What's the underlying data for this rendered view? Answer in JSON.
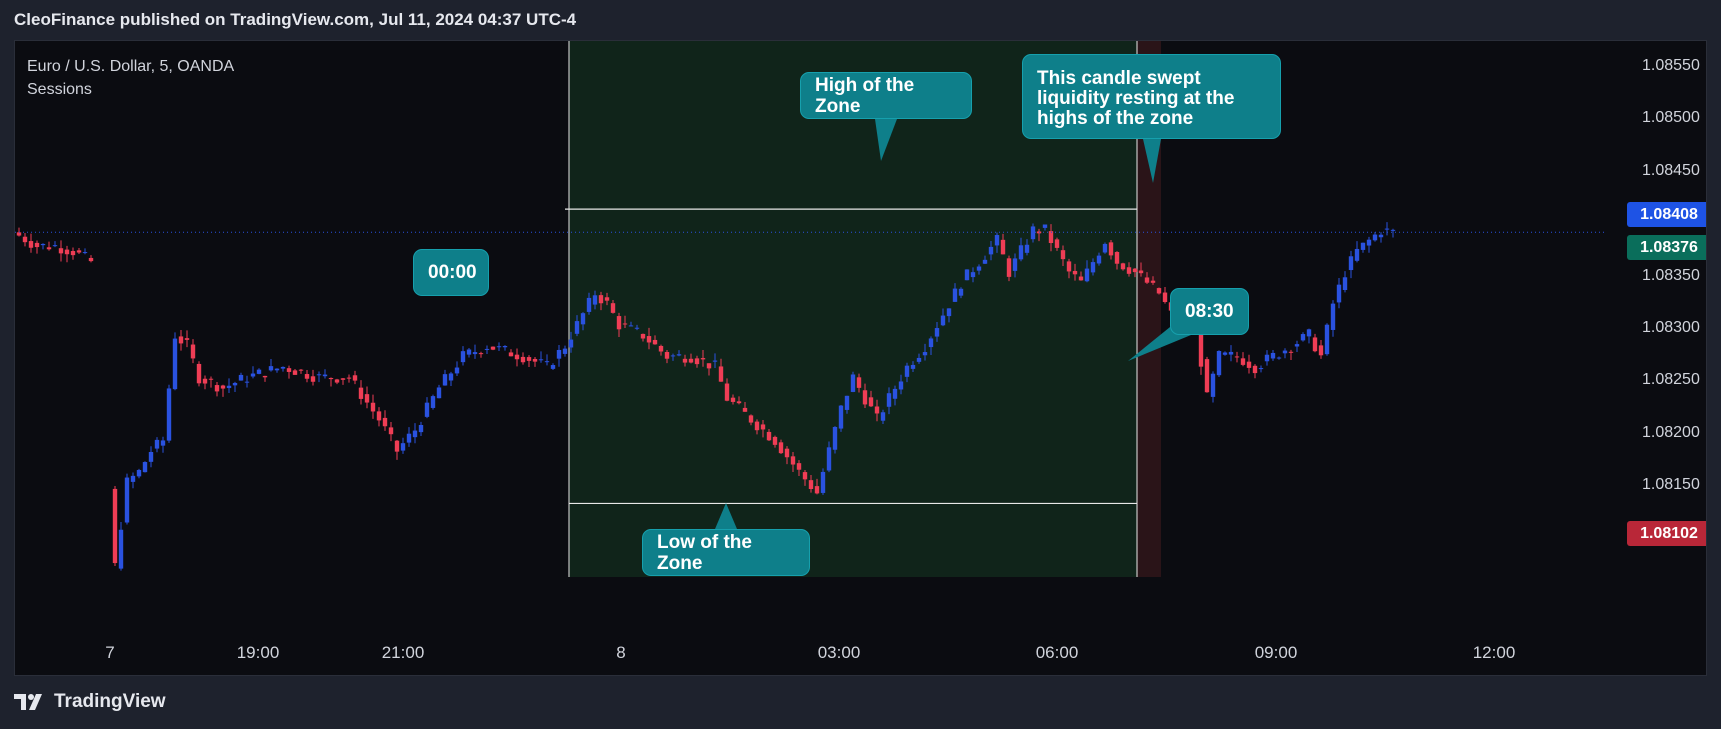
{
  "header": {
    "publish_text": "CleoFinance published on TradingView.com, Jul 11, 2024 04:37 UTC-4"
  },
  "legend": {
    "symbol": "Euro / U.S. Dollar, 5, OANDA",
    "indicator": "Sessions"
  },
  "footer": {
    "brand": "TradingView",
    "logo_icon": "tradingview-logo-icon"
  },
  "colors": {
    "background": "#0b0c11",
    "up_candle": "#2a52e0",
    "down_candle": "#ef3d55",
    "session_fill": "#10241a",
    "sweep_fill": "#2a1418",
    "callout": "#0e7f8a",
    "tag_current": "#1e53e5",
    "tag_green": "#0a6e5b",
    "tag_red": "#b92738"
  },
  "callouts": {
    "session_start": "00:00",
    "session_end": "08:30",
    "zone_high": "High of the Zone",
    "zone_low": "Low of the Zone",
    "sweep_note": "This candle swept liquidity resting at the highs of the zone"
  },
  "price_tags": {
    "current": "1.08408",
    "session_high": "1.08376",
    "session_low": "1.08102"
  },
  "chart_data": {
    "type": "candlestick",
    "title": "Euro / U.S. Dollar, 5, OANDA",
    "y_axis": {
      "ticks": [
        "1.08550",
        "1.08500",
        "1.08450",
        "1.08400",
        "1.08350",
        "1.08300",
        "1.08250",
        "1.08200",
        "1.08150"
      ],
      "ylim": [
        1.0808,
        1.0859
      ]
    },
    "x_axis": {
      "ticks": [
        "7",
        "19:00",
        "21:00",
        "8",
        "03:00",
        "06:00",
        "09:00",
        "12:00"
      ]
    },
    "zone": {
      "start": "00:00",
      "end": "08:30",
      "high": 1.0843,
      "low": 1.0815
    },
    "current_price": 1.08408,
    "approx_close_path": [
      [
        0,
        1.08405
      ],
      [
        3,
        1.08395
      ],
      [
        6,
        1.08395
      ],
      [
        9,
        1.0839
      ],
      [
        12,
        1.0838
      ],
      [
        16,
        1.0809
      ],
      [
        18,
        1.0817
      ],
      [
        20,
        1.0818
      ],
      [
        22,
        1.082
      ],
      [
        24,
        1.0821
      ],
      [
        26,
        1.0831
      ],
      [
        28,
        1.083
      ],
      [
        30,
        1.0827
      ],
      [
        34,
        1.0826
      ],
      [
        38,
        1.0827
      ],
      [
        44,
        1.0828
      ],
      [
        50,
        1.0827
      ],
      [
        55,
        1.0827
      ],
      [
        60,
        1.0823
      ],
      [
        63,
        1.082
      ],
      [
        66,
        1.0822
      ],
      [
        70,
        1.0826
      ],
      [
        74,
        1.0829
      ],
      [
        78,
        1.083
      ],
      [
        84,
        1.0829
      ],
      [
        88,
        1.0828
      ],
      [
        91,
        1.083
      ],
      [
        94,
        1.0833
      ],
      [
        96,
        1.0835
      ],
      [
        98,
        1.0834
      ],
      [
        100,
        1.0832
      ],
      [
        104,
        1.0831
      ],
      [
        108,
        1.0829
      ],
      [
        112,
        1.0829
      ],
      [
        116,
        1.0828
      ],
      [
        118,
        1.0825
      ],
      [
        122,
        1.0823
      ],
      [
        126,
        1.0821
      ],
      [
        130,
        1.0818
      ],
      [
        133,
        1.0816
      ],
      [
        135,
        1.082
      ],
      [
        137,
        1.0824
      ],
      [
        139,
        1.0827
      ],
      [
        141,
        1.0825
      ],
      [
        143,
        1.0823
      ],
      [
        145,
        1.0825
      ],
      [
        148,
        1.0828
      ],
      [
        151,
        1.083
      ],
      [
        154,
        1.0833
      ],
      [
        157,
        1.0836
      ],
      [
        160,
        1.0838
      ],
      [
        163,
        1.084
      ],
      [
        165,
        1.0837
      ],
      [
        167,
        1.0839
      ],
      [
        169,
        1.0841
      ],
      [
        171,
        1.0841
      ],
      [
        173,
        1.0839
      ],
      [
        175,
        1.0837
      ],
      [
        177,
        1.0836
      ],
      [
        179,
        1.0838
      ],
      [
        181,
        1.084
      ],
      [
        183,
        1.0838
      ],
      [
        186,
        1.0837
      ],
      [
        188,
        1.0836
      ],
      [
        190,
        1.0835
      ],
      [
        192,
        1.0833
      ],
      [
        194,
        1.0834
      ],
      [
        196,
        1.0832
      ],
      [
        198,
        1.0825
      ],
      [
        200,
        1.0829
      ],
      [
        203,
        1.0829
      ],
      [
        206,
        1.0828
      ],
      [
        209,
        1.0829
      ],
      [
        212,
        1.083
      ],
      [
        215,
        1.0831
      ],
      [
        217,
        1.0829
      ],
      [
        219,
        1.0834
      ],
      [
        221,
        1.0837
      ],
      [
        223,
        1.0839
      ],
      [
        225,
        1.084
      ],
      [
        227,
        1.0841
      ],
      [
        229,
        1.08408
      ]
    ]
  }
}
